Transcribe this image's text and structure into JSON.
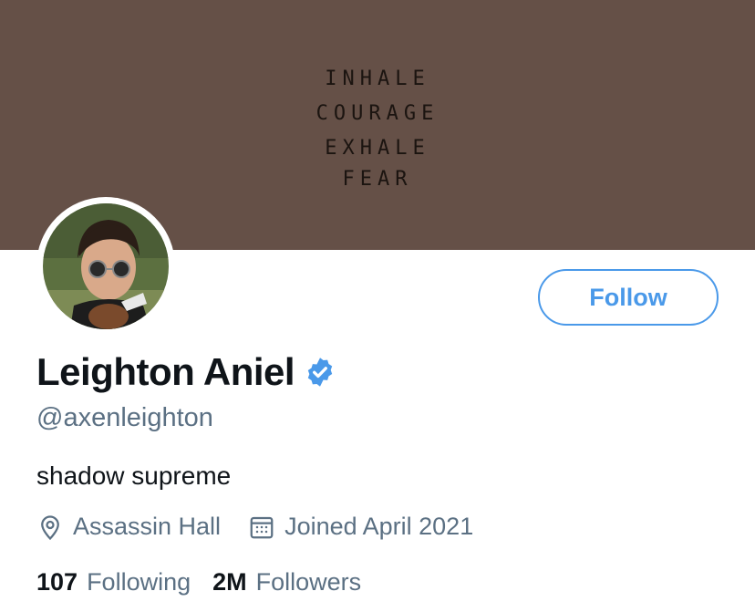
{
  "banner": {
    "color": "#655047",
    "quote_lines": [
      "INHALE",
      "COURAGE",
      "EXHALE",
      "FEAR"
    ]
  },
  "profile": {
    "name": "Leighton Aniel",
    "verified_icon": "verified-badge-icon",
    "handle": "@axenleighton",
    "bio": "shadow supreme",
    "location": "Assassin Hall",
    "joined": "Joined April 2021"
  },
  "actions": {
    "follow_label": "Follow"
  },
  "stats": {
    "following_count": "107",
    "following_label": "Following",
    "followers_count": "2M",
    "followers_label": "Followers"
  },
  "colors": {
    "accent": "#4a99e9",
    "secondary_text": "#5b7083",
    "primary_text": "#0f1419",
    "verified": "#4a99e9"
  }
}
